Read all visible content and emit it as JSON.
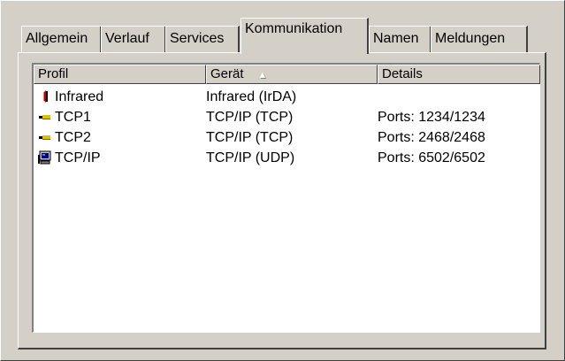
{
  "tabs": [
    {
      "label": "Allgemein",
      "active": false
    },
    {
      "label": "Verlauf",
      "active": false
    },
    {
      "label": "Services",
      "active": false
    },
    {
      "label": "Kommunikation",
      "active": true
    },
    {
      "label": "Namen",
      "active": false
    },
    {
      "label": "Meldungen",
      "active": false
    }
  ],
  "list": {
    "columns": [
      {
        "label": "Profil"
      },
      {
        "label": "Gerät",
        "sorted": "ascending"
      },
      {
        "label": "Details"
      }
    ],
    "rows": [
      {
        "profile": "Infrared",
        "device": "Infrared (IrDA)",
        "details": "",
        "icon": "infrared-icon"
      },
      {
        "profile": "TCP1",
        "device": "TCP/IP (TCP)",
        "details": "Ports: 1234/1234",
        "icon": "cable-connector-icon"
      },
      {
        "profile": "TCP2",
        "device": "TCP/IP (TCP)",
        "details": "Ports: 2468/2468",
        "icon": "cable-connector-icon"
      },
      {
        "profile": "TCP/IP",
        "device": "TCP/IP (UDP)",
        "details": "Ports: 6502/6502",
        "icon": "network-computer-icon"
      }
    ]
  },
  "colors": {
    "face": "#d4d0c8",
    "highlight": "#ffffff",
    "shadow": "#808080",
    "dark_shadow": "#404040",
    "list_background": "#ffffff",
    "infrared_red": "#c00000",
    "connector_yellow": "#e0c000",
    "computer_blue": "#000080"
  },
  "sort_arrow": "▲"
}
